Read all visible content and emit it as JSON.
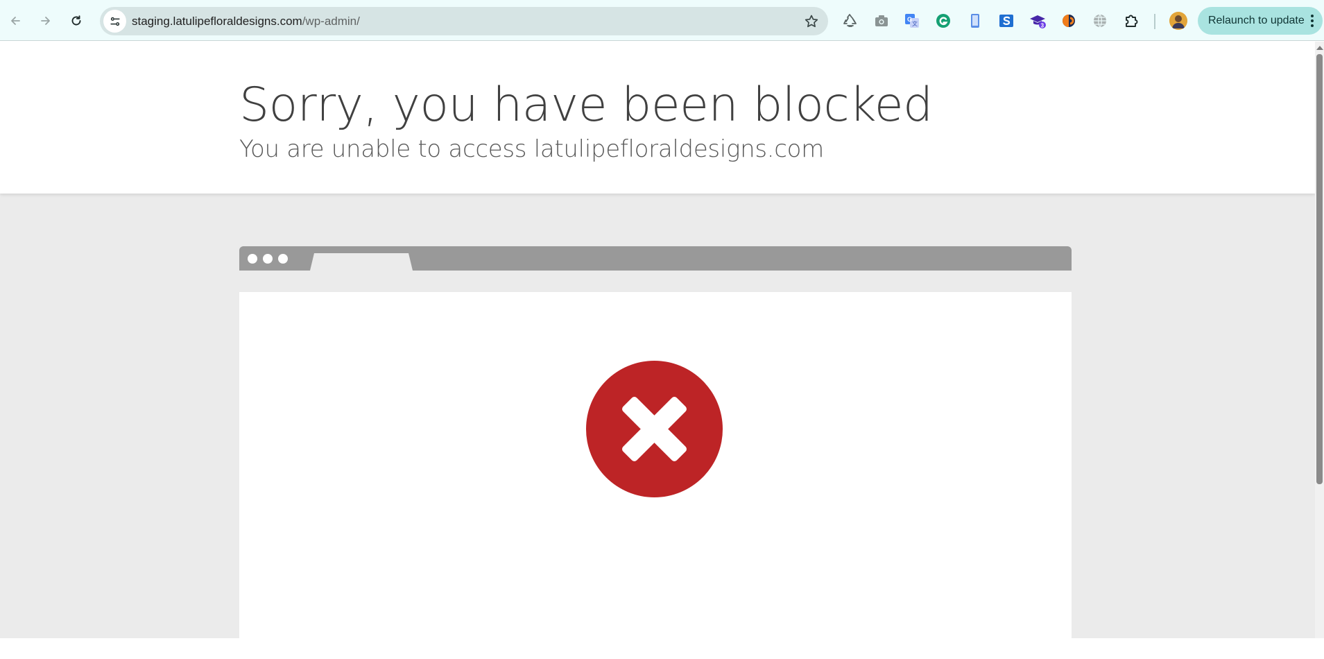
{
  "browser": {
    "url_domain": "staging.latulipefloraldesigns.com",
    "url_path": "/wp-admin/",
    "relaunch_label": "Relaunch to update",
    "extensions_badge": "3",
    "colors": {
      "toolbar_bg": "#eefcfc",
      "omnibox_bg": "#d6e4e4",
      "relaunch_bg": "#a9e3e0"
    },
    "extension_icons": [
      "recycle-icon",
      "camera-icon",
      "google-translate-icon",
      "grammarly-icon",
      "phone-icon",
      "s-app-icon",
      "graduation-cap-icon",
      "orange-half-circle-icon",
      "globe-icon",
      "puzzle-piece-icon"
    ]
  },
  "page": {
    "title": "Sorry, you have been blocked",
    "subtitle": "You are unable to access latulipefloraldesigns.com",
    "colors": {
      "page_bg": "#ebebeb",
      "mock_bar": "#999999",
      "error_red": "#bd2426"
    }
  }
}
